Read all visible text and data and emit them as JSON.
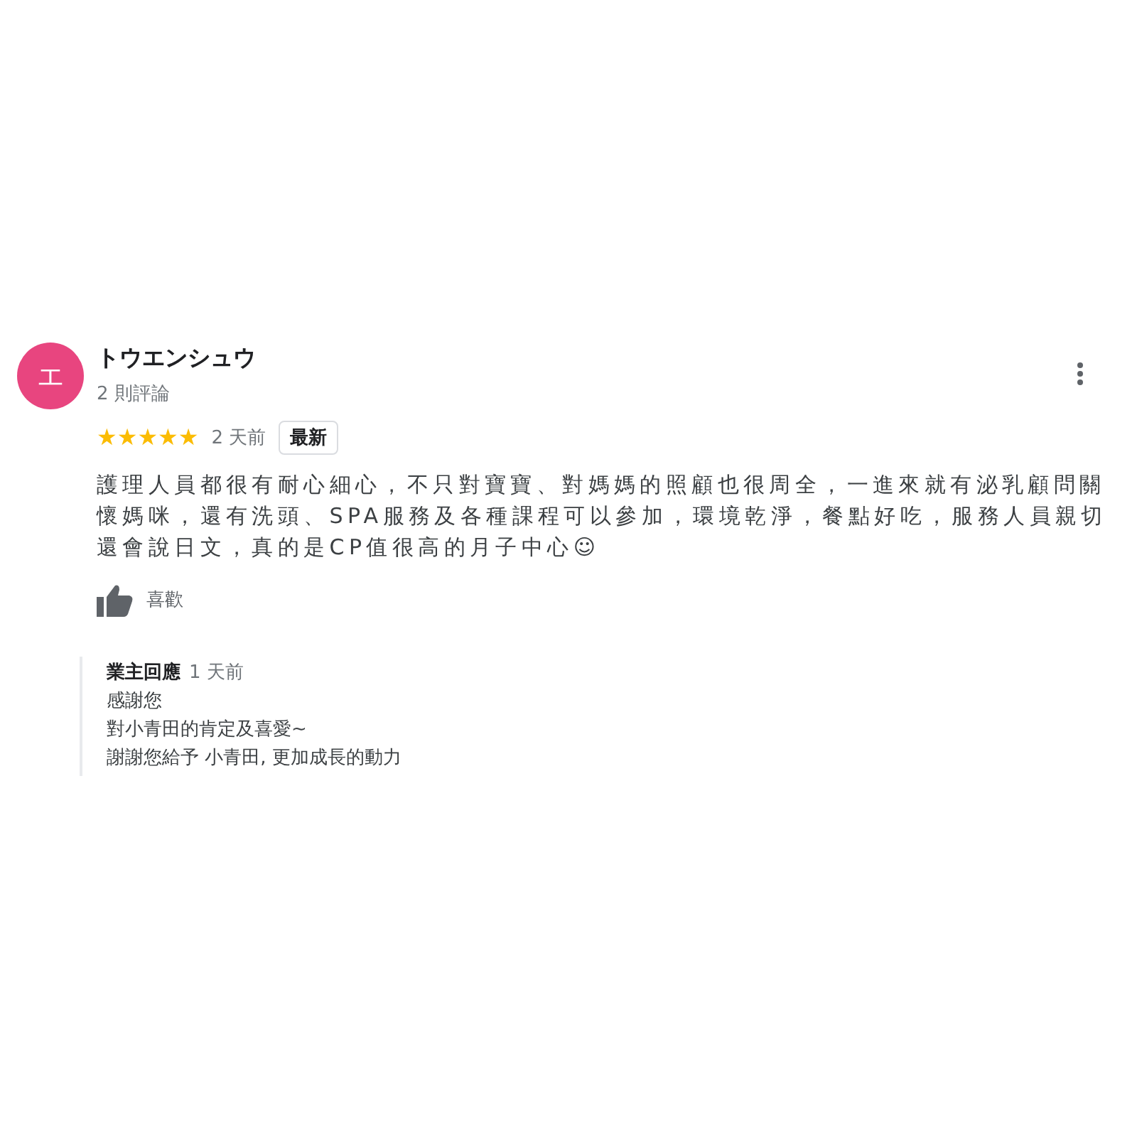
{
  "review": {
    "avatar": {
      "letter": "エ",
      "color": "#e8457f"
    },
    "author": "トウエンシュウ",
    "author_meta": "2 則評論",
    "stars": 5,
    "time": "2 天前",
    "badge": "最新",
    "text": "護理人員都很有耐心細心，不只對寶寶、對媽媽的照顧也很周全，一進來就有泌乳顧問關懷媽咪，還有洗頭、SPA服務及各種課程可以參加，環境乾淨，餐點好吃，服務人員親切還會說日文，真的是CP值很高的月子中心☺",
    "like_label": "喜歡",
    "owner_reply": {
      "title": "業主回應",
      "time": "1 天前",
      "lines": [
        "感謝您",
        "對小青田的肯定及喜愛~",
        "謝謝您給予 小青田, 更加成長的動力"
      ]
    }
  }
}
